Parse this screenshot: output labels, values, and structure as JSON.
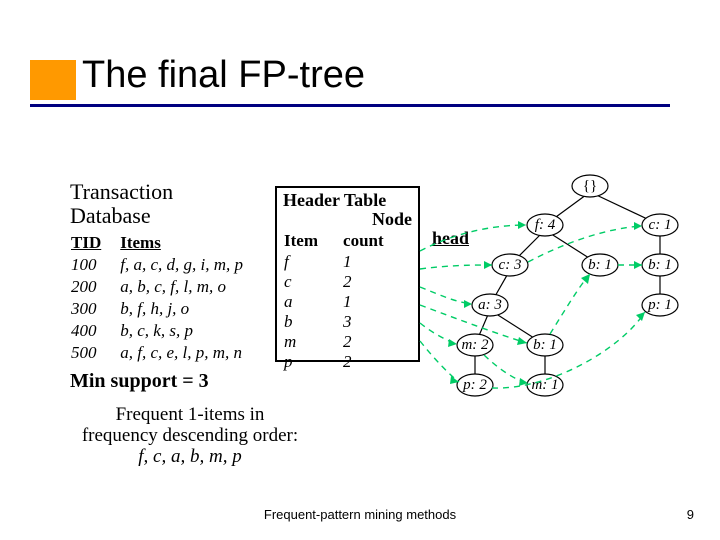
{
  "title": "The final FP-tree",
  "transaction_db": {
    "heading_l1": "Transaction",
    "heading_l2": "Database",
    "col_tid": "TID",
    "col_items": "Items",
    "rows": [
      {
        "tid": "100",
        "items": "f, a, c, d, g, i, m, p"
      },
      {
        "tid": "200",
        "items": "a, b, c, f, l, m, o"
      },
      {
        "tid": "300",
        "items": "b, f, h, j, o"
      },
      {
        "tid": "400",
        "items": "b, c, k, s, p"
      },
      {
        "tid": "500",
        "items": "a, f, c, e, l, p, m, n"
      }
    ]
  },
  "min_support": "Min support = 3",
  "freq_items": {
    "line1": "Frequent 1-items in",
    "line2": "frequency descending order:",
    "order": "f, c, a, b, m, p"
  },
  "header_table": {
    "title": "Header Table",
    "sub": "Node",
    "col_item": "Item",
    "col_count": "count",
    "rows": [
      {
        "item": "f",
        "count": "1"
      },
      {
        "item": "c",
        "count": "2"
      },
      {
        "item": "a",
        "count": "1"
      },
      {
        "item": "b",
        "count": "3"
      },
      {
        "item": "m",
        "count": "2"
      },
      {
        "item": "p",
        "count": "2"
      }
    ]
  },
  "head_label": "head",
  "tree": {
    "root": "{}",
    "nodes": {
      "f4": "f: 4",
      "c1": "c: 1",
      "c3": "c: 3",
      "b1a": "b: 1",
      "b1b": "b: 1",
      "a3": "a: 3",
      "p1": "p: 1",
      "m2": "m: 2",
      "b1c": "b: 1",
      "p2": "p: 2",
      "m1": "m: 1"
    }
  },
  "footer": "Frequent-pattern mining methods",
  "slide_number": "9"
}
